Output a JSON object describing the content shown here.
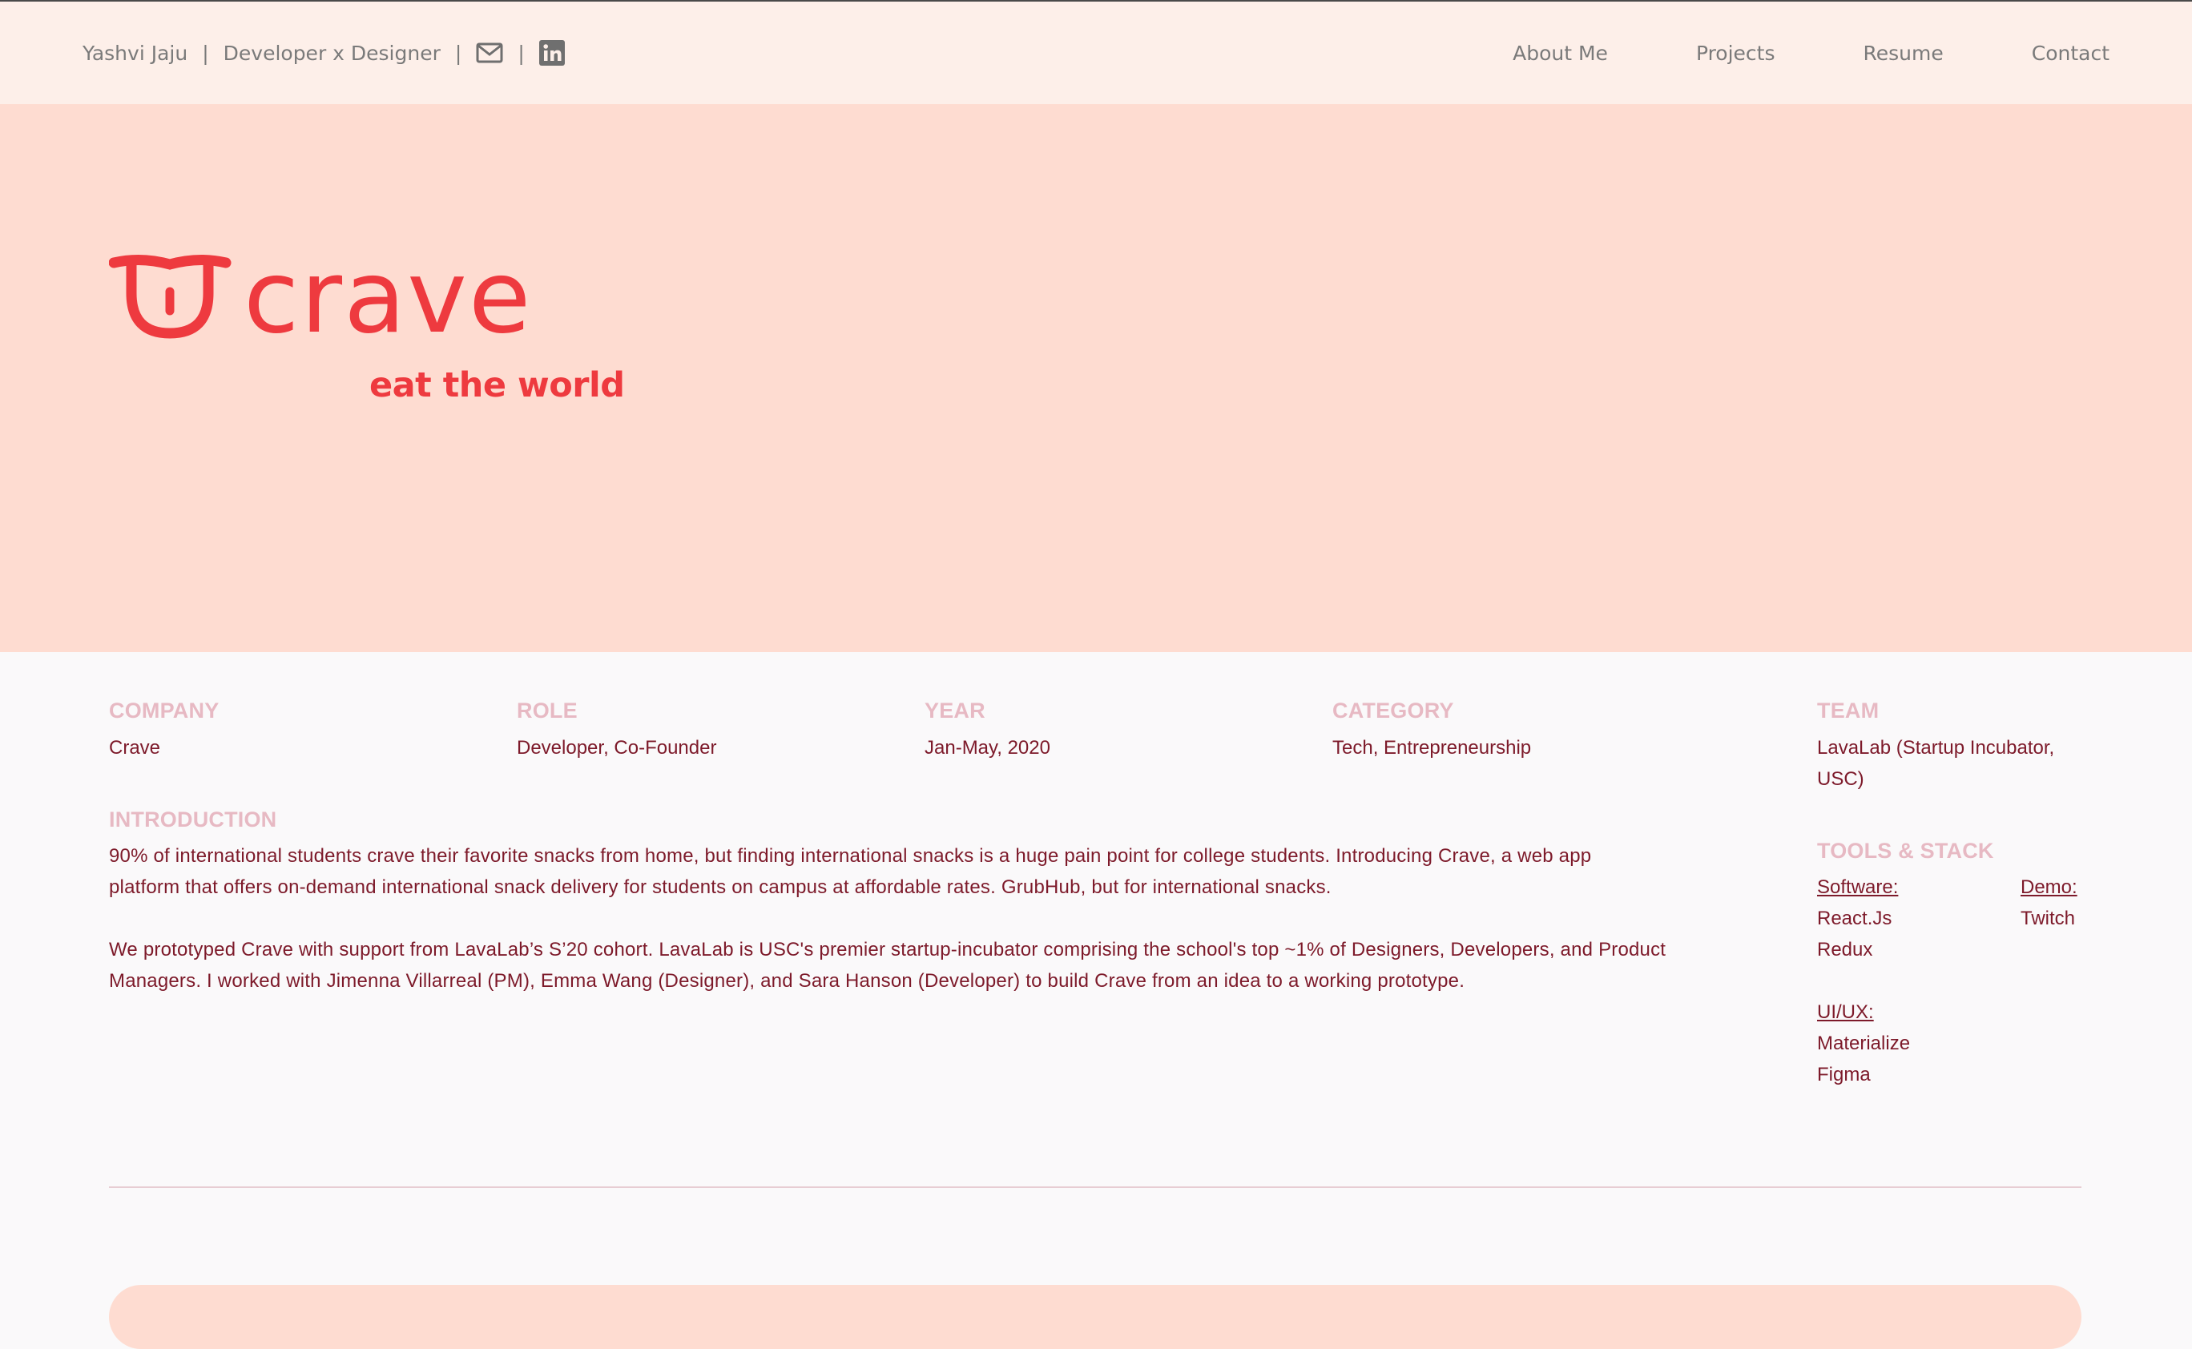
{
  "header": {
    "name": "Yashvi Jaju",
    "separator": "|",
    "tagline": "Developer x Designer",
    "icons": [
      "mail-icon",
      "linkedin-icon"
    ],
    "nav": [
      "About Me",
      "Projects",
      "Resume",
      "Contact"
    ]
  },
  "hero": {
    "logo_text": "crave",
    "tagline": "eat the world",
    "brand_color": "#ee3a3f",
    "background": "#fedcd1"
  },
  "details": {
    "company": {
      "label": "COMPANY",
      "value": "Crave"
    },
    "role": {
      "label": "ROLE",
      "value": "Developer, Co-Founder"
    },
    "year": {
      "label": "YEAR",
      "value": "Jan-May, 2020"
    },
    "category": {
      "label": "CATEGORY",
      "value": "Tech, Entrepreneurship"
    },
    "team": {
      "label": "TEAM",
      "value_line1": "LavaLab (Startup Incubator,",
      "value_line2": "USC)"
    }
  },
  "introduction": {
    "label": "INTRODUCTION",
    "p1_line1": "90% of international students crave their favorite snacks from home, but finding international snacks is a huge pain point for college students. Introducing Crave, a web app",
    "p1_line2": "platform that offers on-demand international snack delivery for students on campus at affordable rates. GrubHub, but for international snacks.",
    "p2_line1": "We prototyped Crave with support from LavaLab’s S’20 cohort. LavaLab is USC's premier startup-incubator comprising the school's top ~1% of Designers, Developers, and Product",
    "p2_line2": "Managers. I worked with Jimenna Villarreal (PM), Emma Wang (Designer), and Sara Hanson (Developer) to build Crave from an idea to a working prototype."
  },
  "tools": {
    "label": "TOOLS & STACK",
    "software_label": "Software:",
    "software": [
      "React.Js",
      "Redux"
    ],
    "demo_label": "Demo:",
    "demo": [
      "Twitch"
    ],
    "uiux_label": "UI/UX:",
    "uiux": [
      "Materialize",
      "Figma"
    ]
  }
}
